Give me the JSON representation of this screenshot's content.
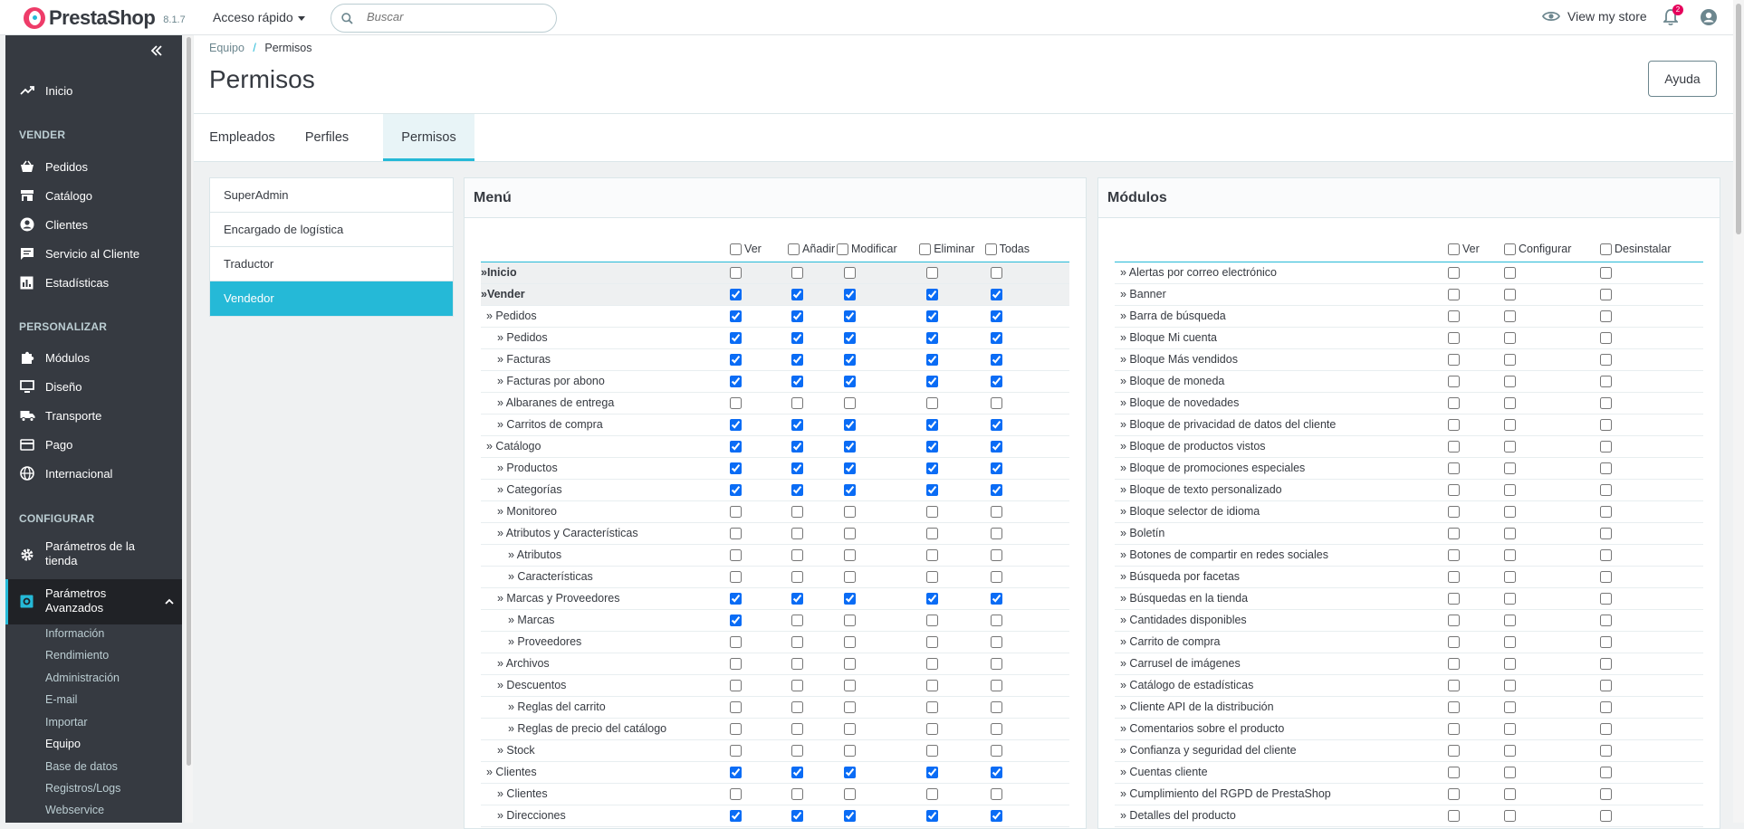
{
  "topbar": {
    "brand": "PrestaShop",
    "version": "8.1.7",
    "quick_access": "Acceso rápido",
    "search_placeholder": "Buscar",
    "view_store": "View my store",
    "notifications_count": "2"
  },
  "sidebar": {
    "home": "Inicio",
    "sections": {
      "sell": "VENDER",
      "customize": "PERSONALIZAR",
      "configure": "CONFIGURAR"
    },
    "sell_items": [
      "Pedidos",
      "Catálogo",
      "Clientes",
      "Servicio al Cliente",
      "Estadísticas"
    ],
    "customize_items": [
      "Módulos",
      "Diseño",
      "Transporte",
      "Pago",
      "Internacional"
    ],
    "configure_items": {
      "shop_params_1": "Parámetros de la",
      "shop_params_2": "tienda",
      "advanced_1": "Parámetros",
      "advanced_2": "Avanzados"
    },
    "advanced_sub": [
      "Información",
      "Rendimiento",
      "Administración",
      "E-mail",
      "Importar",
      "Equipo",
      "Base de datos",
      "Registros/Logs",
      "Webservice"
    ],
    "active_sub": "Equipo"
  },
  "header": {
    "breadcrumb_parent": "Equipo",
    "breadcrumb_sep": "/",
    "breadcrumb_current": "Permisos",
    "title": "Permisos",
    "help": "Ayuda"
  },
  "tabs": [
    "Empleados",
    "Perfiles",
    "Permisos"
  ],
  "active_tab": "Permisos",
  "profiles": [
    "SuperAdmin",
    "Encargado de logística",
    "Traductor",
    "Vendedor"
  ],
  "active_profile": "Vendedor",
  "menu_panel": {
    "title": "Menú",
    "columns": [
      "Ver",
      "Añadir",
      "Modificar",
      "Eliminar",
      "Todas"
    ],
    "rows": [
      {
        "label": "»Inicio",
        "checks": [
          false,
          false,
          false,
          false,
          false
        ],
        "grey": true
      },
      {
        "label": "»Vender",
        "checks": [
          true,
          true,
          true,
          true,
          true
        ],
        "grey": true
      },
      {
        "label": "» Pedidos",
        "checks": [
          true,
          true,
          true,
          true,
          true
        ]
      },
      {
        "label": "» Pedidos",
        "checks": [
          true,
          true,
          true,
          true,
          true
        ],
        "indent": 1
      },
      {
        "label": "» Facturas",
        "checks": [
          true,
          true,
          true,
          true,
          true
        ],
        "indent": 1
      },
      {
        "label": "» Facturas por abono",
        "checks": [
          true,
          true,
          true,
          true,
          true
        ],
        "indent": 1
      },
      {
        "label": "» Albaranes de entrega",
        "checks": [
          false,
          false,
          false,
          false,
          false
        ],
        "indent": 1
      },
      {
        "label": "» Carritos de compra",
        "checks": [
          true,
          true,
          true,
          true,
          true
        ],
        "indent": 1
      },
      {
        "label": "» Catálogo",
        "checks": [
          true,
          true,
          true,
          true,
          true
        ]
      },
      {
        "label": "» Productos",
        "checks": [
          true,
          true,
          true,
          true,
          true
        ],
        "indent": 1
      },
      {
        "label": "» Categorías",
        "checks": [
          true,
          true,
          true,
          true,
          true
        ],
        "indent": 1
      },
      {
        "label": "» Monitoreo",
        "checks": [
          false,
          false,
          false,
          false,
          false
        ],
        "indent": 1
      },
      {
        "label": "» Atributos y Características",
        "checks": [
          false,
          false,
          false,
          false,
          false
        ],
        "indent": 1
      },
      {
        "label": "» Atributos",
        "checks": [
          false,
          false,
          false,
          false,
          false
        ],
        "indent": 2
      },
      {
        "label": "» Características",
        "checks": [
          false,
          false,
          false,
          false,
          false
        ],
        "indent": 2
      },
      {
        "label": "» Marcas y Proveedores",
        "checks": [
          true,
          true,
          true,
          true,
          true
        ],
        "indent": 1
      },
      {
        "label": "» Marcas",
        "checks": [
          true,
          false,
          false,
          false,
          false
        ],
        "indent": 2
      },
      {
        "label": "» Proveedores",
        "checks": [
          false,
          false,
          false,
          false,
          false
        ],
        "indent": 2
      },
      {
        "label": "» Archivos",
        "checks": [
          false,
          false,
          false,
          false,
          false
        ],
        "indent": 1
      },
      {
        "label": "» Descuentos",
        "checks": [
          false,
          false,
          false,
          false,
          false
        ],
        "indent": 1
      },
      {
        "label": "» Reglas del carrito",
        "checks": [
          false,
          false,
          false,
          false,
          false
        ],
        "indent": 2
      },
      {
        "label": "» Reglas de precio del catálogo",
        "checks": [
          false,
          false,
          false,
          false,
          false
        ],
        "indent": 2
      },
      {
        "label": "» Stock",
        "checks": [
          false,
          false,
          false,
          false,
          false
        ],
        "indent": 1
      },
      {
        "label": "» Clientes",
        "checks": [
          true,
          true,
          true,
          true,
          true
        ]
      },
      {
        "label": "» Clientes",
        "checks": [
          false,
          false,
          false,
          false,
          false
        ],
        "indent": 1
      },
      {
        "label": "» Direcciones",
        "checks": [
          true,
          true,
          true,
          true,
          true
        ],
        "indent": 1
      }
    ]
  },
  "modules_panel": {
    "title": "Módulos",
    "columns": [
      "Ver",
      "Configurar",
      "Desinstalar"
    ],
    "rows": [
      "» Alertas por correo electrónico",
      "» Banner",
      "» Barra de búsqueda",
      "» Bloque Mi cuenta",
      "» Bloque Más vendidos",
      "» Bloque de moneda",
      "» Bloque de novedades",
      "» Bloque de privacidad de datos del cliente",
      "» Bloque de productos vistos",
      "» Bloque de promociones especiales",
      "» Bloque de texto personalizado",
      "» Bloque selector de idioma",
      "» Boletín",
      "» Botones de compartir en redes sociales",
      "» Búsqueda por facetas",
      "» Búsquedas en la tienda",
      "» Cantidades disponibles",
      "» Carrito de compra",
      "» Carrusel de imágenes",
      "» Catálogo de estadísticas",
      "» Cliente API de la distribución",
      "» Comentarios sobre el producto",
      "» Confianza y seguridad del cliente",
      "» Cuentas cliente",
      "» Cumplimiento del RGPD de PrestaShop",
      "» Detalles del producto"
    ]
  }
}
